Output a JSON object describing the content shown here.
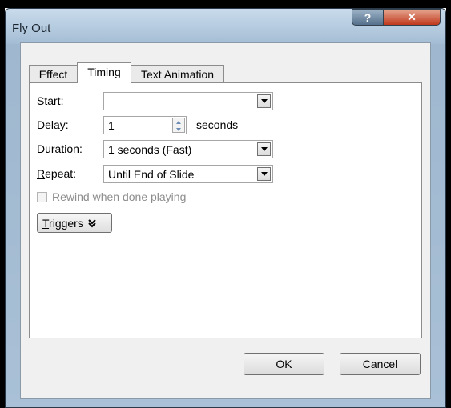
{
  "window": {
    "title": "Fly Out",
    "help_label": "?",
    "close_label": "✕"
  },
  "tabs": [
    {
      "label": "Effect"
    },
    {
      "label": "Timing"
    },
    {
      "label": "Text Animation"
    }
  ],
  "active_tab": "Timing",
  "fields": {
    "start": {
      "label_pre": "",
      "label_u": "S",
      "label_post": "tart:",
      "value": ""
    },
    "delay": {
      "label_pre": "",
      "label_u": "D",
      "label_post": "elay:",
      "value": "1",
      "unit": "seconds"
    },
    "duration": {
      "label_pre": "Duratio",
      "label_u": "n",
      "label_post": ":",
      "value": "1 seconds (Fast)"
    },
    "repeat": {
      "label_pre": "",
      "label_u": "R",
      "label_post": "epeat:",
      "value": "Until End of Slide"
    }
  },
  "rewind": {
    "label_pre": "Re",
    "label_u": "w",
    "label_post": "ind when done playing",
    "checked": false,
    "enabled": false
  },
  "triggers": {
    "label_u": "T",
    "label_post": "riggers",
    "icon": "double-chevron-down-icon"
  },
  "buttons": {
    "ok": "OK",
    "cancel": "Cancel"
  },
  "colors": {
    "frame": "#a9c0d6",
    "close": "#c0391c",
    "client": "#f0f0f0"
  }
}
